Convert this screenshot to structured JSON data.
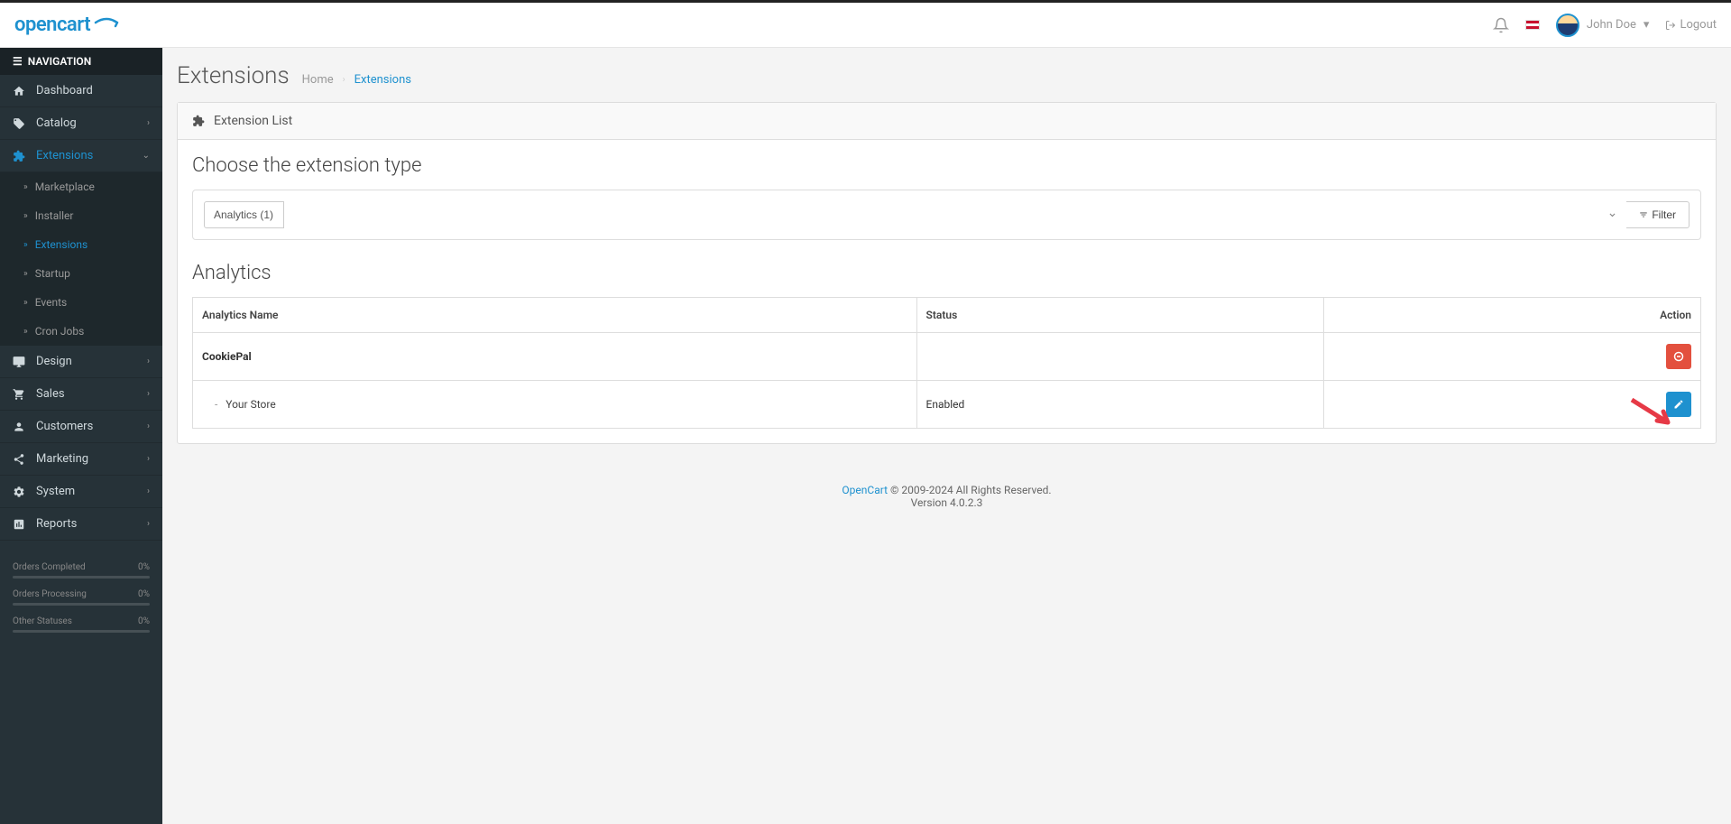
{
  "header": {
    "logo_text": "opencart",
    "user_name": "John Doe",
    "logout_label": "Logout"
  },
  "sidebar": {
    "nav_title": "NAVIGATION",
    "items": {
      "dashboard": "Dashboard",
      "catalog": "Catalog",
      "extensions": "Extensions",
      "design": "Design",
      "sales": "Sales",
      "customers": "Customers",
      "marketing": "Marketing",
      "system": "System",
      "reports": "Reports"
    },
    "sub_extensions": {
      "marketplace": "Marketplace",
      "installer": "Installer",
      "extensions": "Extensions",
      "startup": "Startup",
      "events": "Events",
      "cron_jobs": "Cron Jobs"
    },
    "stats": [
      {
        "label": "Orders Completed",
        "value": "0%"
      },
      {
        "label": "Orders Processing",
        "value": "0%"
      },
      {
        "label": "Other Statuses",
        "value": "0%"
      }
    ]
  },
  "page": {
    "title": "Extensions",
    "breadcrumb_home": "Home",
    "breadcrumb_current": "Extensions",
    "panel_title": "Extension List",
    "choose_label": "Choose the extension type",
    "selected_type": "Analytics (1)",
    "filter_label": "Filter",
    "table_title": "Analytics",
    "columns": {
      "name": "Analytics Name",
      "status": "Status",
      "action": "Action"
    },
    "rows": {
      "extension_name": "CookiePal",
      "store_prefix": "-",
      "store_name": "Your Store",
      "store_status": "Enabled"
    }
  },
  "footer": {
    "link_text": "OpenCart",
    "rights": " © 2009-2024 All Rights Reserved.",
    "version": "Version 4.0.2.3"
  }
}
